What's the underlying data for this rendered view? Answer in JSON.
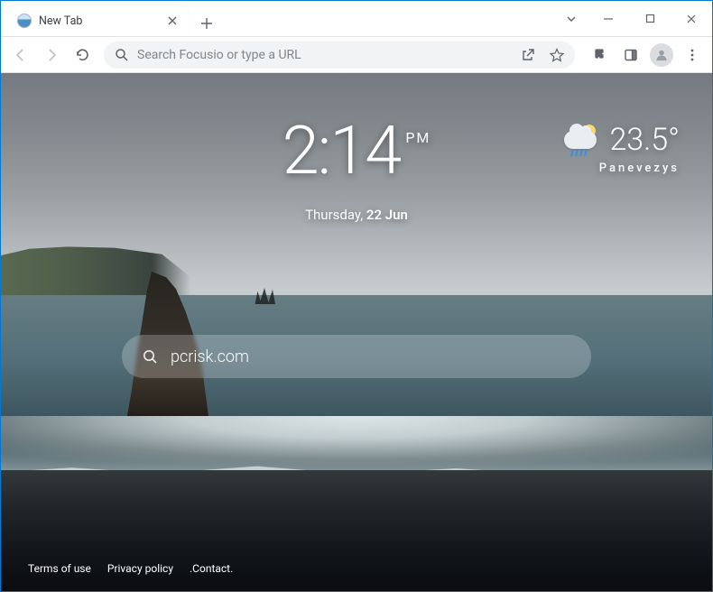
{
  "tab": {
    "title": "New Tab"
  },
  "omnibox": {
    "placeholder": "Search Focusio or type a URL"
  },
  "clock": {
    "time": "2:14",
    "ampm": "PM",
    "day": "Thursday,",
    "date": "22 Jun"
  },
  "weather": {
    "temp": "23.5°",
    "city": "Panevezys"
  },
  "search": {
    "value": "pcrisk.com"
  },
  "footer": {
    "terms": "Terms of use",
    "privacy": "Privacy policy",
    "contact": ".Contact."
  }
}
